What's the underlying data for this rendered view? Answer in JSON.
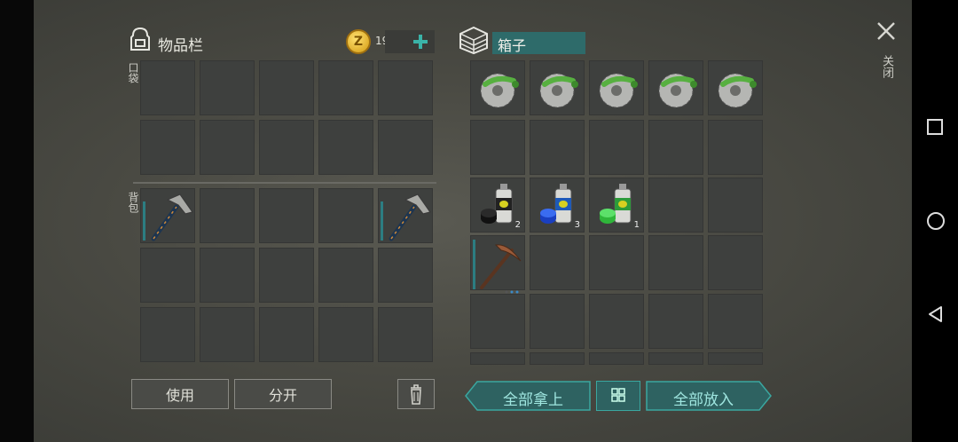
{
  "inventory": {
    "title": "物品栏",
    "pocket_label": "口袋",
    "backpack_label": "背包",
    "coins": "19",
    "use_button": "使用",
    "split_button": "分开"
  },
  "chest": {
    "title": "箱子",
    "take_all_button": "全部拿上",
    "put_all_button": "全部放入",
    "counts": {
      "black_paint": "2",
      "blue_paint": "3",
      "green_paint": "1"
    }
  },
  "close_label": "关闭",
  "colors": {
    "accent_teal": "#3aa7a0",
    "panel_bg": "#4a4a43",
    "coin_gold": "#e0b020"
  },
  "icons": [
    "backpack-icon",
    "coin-icon",
    "plus-icon",
    "chest-icon",
    "close-icon",
    "trash-icon",
    "grid-sort-icon",
    "saw-blade-icon",
    "spray-paint-icon",
    "hatchet-icon",
    "pickaxe-icon",
    "square-nav-icon",
    "circle-nav-icon",
    "back-triangle-nav-icon"
  ]
}
